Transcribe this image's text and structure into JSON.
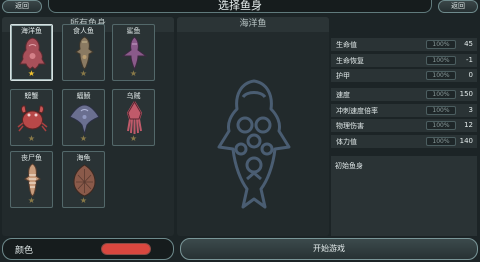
{
  "header": {
    "back_left": "返回",
    "back_right": "返回",
    "title": "选择鱼身"
  },
  "left_panel": {
    "title": "所有鱼身",
    "cards": [
      {
        "label": "海洋鱼",
        "icon": "sea-fish-icon",
        "star_color": "#f0c22e",
        "selected": true
      },
      {
        "label": "食人鱼",
        "icon": "piranha-icon",
        "star_color": "#8a7a48",
        "selected": false
      },
      {
        "label": "鲨鱼",
        "icon": "shark-icon",
        "star_color": "#8a7a48",
        "selected": false
      },
      {
        "label": "螃蟹",
        "icon": "crab-icon",
        "star_color": "#8a7a48",
        "selected": false
      },
      {
        "label": "蝠鲼",
        "icon": "manta-ray-icon",
        "star_color": "#8a7a48",
        "selected": false
      },
      {
        "label": "乌贼",
        "icon": "squid-icon",
        "star_color": "#8a7a48",
        "selected": false
      },
      {
        "label": "丧尸鱼",
        "icon": "zombie-fish-icon",
        "star_color": "#8a7a48",
        "selected": false
      },
      {
        "label": "海龟",
        "icon": "sea-turtle-icon",
        "star_color": "#8a7a48",
        "selected": false
      }
    ]
  },
  "color_bar": {
    "label": "颜色",
    "swatch_color": "#d9473f"
  },
  "preview": {
    "title": "海洋鱼",
    "icon": "sea-fish-outline-icon"
  },
  "stats": [
    {
      "name": "生命值",
      "pct": "100%",
      "value": "45"
    },
    {
      "name": "生命恢复",
      "pct": "100%",
      "value": "-1"
    },
    {
      "name": "护甲",
      "pct": "100%",
      "value": "0"
    },
    {
      "name": "速度",
      "pct": "100%",
      "value": "150"
    },
    {
      "name": "冲刺速度倍率",
      "pct": "100%",
      "value": "3"
    },
    {
      "name": "物理伤害",
      "pct": "100%",
      "value": "12"
    },
    {
      "name": "体力值",
      "pct": "100%",
      "value": "140"
    }
  ],
  "description": "初始鱼身",
  "start_button": "开始游戏"
}
